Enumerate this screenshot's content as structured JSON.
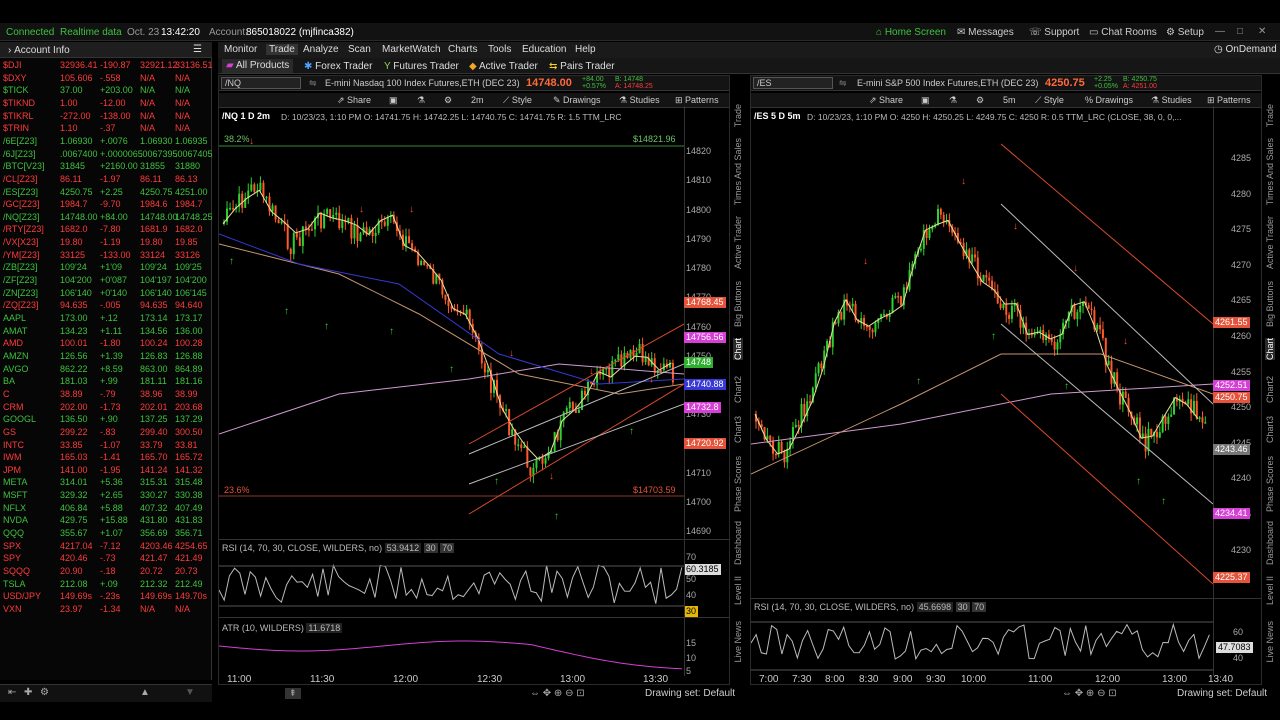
{
  "topbar": {
    "connected": "Connected",
    "realtime": "Realtime data",
    "date": "Oct. 23",
    "time": "13:42:20",
    "account_label": "Account:",
    "account_value": "865018022 (mjfinca382)",
    "home": "Home Screen",
    "messages": "Messages",
    "support": "Support",
    "chatrooms": "Chat Rooms",
    "setup": "Setup",
    "ondemand": "OnDemand"
  },
  "tabs": [
    "Monitor",
    "Trade",
    "Analyze",
    "Scan",
    "MarketWatch",
    "Charts",
    "Tools",
    "Education",
    "Help"
  ],
  "subtabs": [
    "All Products",
    "Forex Trader",
    "Futures Trader",
    "Active Trader",
    "Pairs Trader"
  ],
  "watchlist": {
    "header": "Account Info",
    "rows": [
      {
        "sym": "$DJI",
        "last": "32936.41",
        "chg": "-190.87",
        "bid": "32921.12",
        "ask": "33136.51",
        "up": false
      },
      {
        "sym": "$DXY",
        "last": "105.606",
        "chg": "-.558",
        "bid": "N/A",
        "ask": "N/A",
        "up": false
      },
      {
        "sym": "$TICK",
        "last": "37.00",
        "chg": "+203.00",
        "bid": "N/A",
        "ask": "N/A",
        "up": true
      },
      {
        "sym": "$TIKND",
        "last": "1.00",
        "chg": "-12.00",
        "bid": "N/A",
        "ask": "N/A",
        "up": false
      },
      {
        "sym": "$TIKRL",
        "last": "-272.00",
        "chg": "-138.00",
        "bid": "N/A",
        "ask": "N/A",
        "up": false
      },
      {
        "sym": "$TRIN",
        "last": "1.10",
        "chg": "-.37",
        "bid": "N/A",
        "ask": "N/A",
        "up": false
      },
      {
        "sym": "/6E[Z23]",
        "last": "1.06930",
        "chg": "+.0076",
        "bid": "1.06930",
        "ask": "1.06935",
        "up": true
      },
      {
        "sym": "/6J[Z23]",
        "last": ".0067400",
        "chg": "+.0000065",
        "bid": ".0067395",
        "ask": ".0067405",
        "up": true
      },
      {
        "sym": "/BTC[V23]",
        "last": "31845",
        "chg": "+2160.00",
        "bid": "31855",
        "ask": "31880",
        "up": true
      },
      {
        "sym": "/CL[Z23]",
        "last": "86.11",
        "chg": "-1.97",
        "bid": "86.11",
        "ask": "86.13",
        "up": false
      },
      {
        "sym": "/ES[Z23]",
        "last": "4250.75",
        "chg": "+2.25",
        "bid": "4250.75",
        "ask": "4251.00",
        "up": true
      },
      {
        "sym": "/GC[Z23]",
        "last": "1984.7",
        "chg": "-9.70",
        "bid": "1984.6",
        "ask": "1984.7",
        "up": false
      },
      {
        "sym": "/NQ[Z23]",
        "last": "14748.00",
        "chg": "+84.00",
        "bid": "14748.00",
        "ask": "14748.25",
        "up": true
      },
      {
        "sym": "/RTY[Z23]",
        "last": "1682.0",
        "chg": "-7.80",
        "bid": "1681.9",
        "ask": "1682.0",
        "up": false
      },
      {
        "sym": "/VX[X23]",
        "last": "19.80",
        "chg": "-1.19",
        "bid": "19.80",
        "ask": "19.85",
        "up": false
      },
      {
        "sym": "/YM[Z23]",
        "last": "33125",
        "chg": "-133.00",
        "bid": "33124",
        "ask": "33126",
        "up": false
      },
      {
        "sym": "/ZB[Z23]",
        "last": "109'24",
        "chg": "+1'09",
        "bid": "109'24",
        "ask": "109'25",
        "up": true
      },
      {
        "sym": "/ZF[Z23]",
        "last": "104'200",
        "chg": "+0'087",
        "bid": "104'197",
        "ask": "104'200",
        "up": true
      },
      {
        "sym": "/ZN[Z23]",
        "last": "106'140",
        "chg": "+0'140",
        "bid": "106'140",
        "ask": "106'145",
        "up": true
      },
      {
        "sym": "/ZQ[Z23]",
        "last": "94.635",
        "chg": "-.005",
        "bid": "94.635",
        "ask": "94.640",
        "up": false
      },
      {
        "sym": "AAPL",
        "last": "173.00",
        "chg": "+.12",
        "bid": "173.14",
        "ask": "173.17",
        "up": true
      },
      {
        "sym": "AMAT",
        "last": "134.23",
        "chg": "+1.11",
        "bid": "134.56",
        "ask": "136.00",
        "up": true
      },
      {
        "sym": "AMD",
        "last": "100.01",
        "chg": "-1.80",
        "bid": "100.24",
        "ask": "100.28",
        "up": false
      },
      {
        "sym": "AMZN",
        "last": "126.56",
        "chg": "+1.39",
        "bid": "126.83",
        "ask": "126.88",
        "up": true
      },
      {
        "sym": "AVGO",
        "last": "862.22",
        "chg": "+8.59",
        "bid": "863.00",
        "ask": "864.89",
        "up": true
      },
      {
        "sym": "BA",
        "last": "181.03",
        "chg": "+.99",
        "bid": "181.11",
        "ask": "181.16",
        "up": true
      },
      {
        "sym": "C",
        "last": "38.89",
        "chg": "-.79",
        "bid": "38.96",
        "ask": "38.99",
        "up": false
      },
      {
        "sym": "CRM",
        "last": "202.00",
        "chg": "-1.73",
        "bid": "202.01",
        "ask": "203.68",
        "up": false
      },
      {
        "sym": "GOOGL",
        "last": "136.50",
        "chg": "+.90",
        "bid": "137.25",
        "ask": "137.29",
        "up": true
      },
      {
        "sym": "GS",
        "last": "299.22",
        "chg": "-.83",
        "bid": "299.40",
        "ask": "300.50",
        "up": false
      },
      {
        "sym": "INTC",
        "last": "33.85",
        "chg": "-1.07",
        "bid": "33.79",
        "ask": "33.81",
        "up": false
      },
      {
        "sym": "IWM",
        "last": "165.03",
        "chg": "-1.41",
        "bid": "165.70",
        "ask": "165.72",
        "up": false
      },
      {
        "sym": "JPM",
        "last": "141.00",
        "chg": "-1.95",
        "bid": "141.24",
        "ask": "141.32",
        "up": false
      },
      {
        "sym": "META",
        "last": "314.01",
        "chg": "+5.36",
        "bid": "315.31",
        "ask": "315.48",
        "up": true
      },
      {
        "sym": "MSFT",
        "last": "329.32",
        "chg": "+2.65",
        "bid": "330.27",
        "ask": "330.38",
        "up": true
      },
      {
        "sym": "NFLX",
        "last": "406.84",
        "chg": "+5.88",
        "bid": "407.32",
        "ask": "407.49",
        "up": true
      },
      {
        "sym": "NVDA",
        "last": "429.75",
        "chg": "+15.88",
        "bid": "431.80",
        "ask": "431.83",
        "up": true
      },
      {
        "sym": "QQQ",
        "last": "355.67",
        "chg": "+1.07",
        "bid": "356.69",
        "ask": "356.71",
        "up": true
      },
      {
        "sym": "SPX",
        "last": "4217.04",
        "chg": "-7.12",
        "bid": "4203.46",
        "ask": "4254.65",
        "up": false
      },
      {
        "sym": "SPY",
        "last": "420.46",
        "chg": "-.73",
        "bid": "421.47",
        "ask": "421.49",
        "up": false
      },
      {
        "sym": "SQQQ",
        "last": "20.90",
        "chg": "-.18",
        "bid": "20.72",
        "ask": "20.73",
        "up": false
      },
      {
        "sym": "TSLA",
        "last": "212.08",
        "chg": "+.09",
        "bid": "212.32",
        "ask": "212.49",
        "up": true
      },
      {
        "sym": "USD/JPY",
        "last": "149.69s",
        "chg": "-.23s",
        "bid": "149.69s",
        "ask": "149.70s",
        "up": false
      },
      {
        "sym": "VXN",
        "last": "23.97",
        "chg": "-1.34",
        "bid": "N/A",
        "ask": "N/A",
        "up": false
      }
    ]
  },
  "chart_left": {
    "symbol": "/NQ",
    "desc": "E-mini Nasdaq 100 Index Futures,ETH (DEC 23)",
    "price": "14748.00",
    "bid": "B: 14748",
    "ask": "A: 14748.25",
    "chg": "+84.00",
    "chgpct": "+0.57%",
    "header": "/NQ 1 D 2m",
    "ohlc": "D: 10/23/23, 1:10 PM  O: 14741.75  H: 14742.25  L: 14740.75  C: 14741.75  R: 1.5  TTM_LRC",
    "tf": "2m",
    "fib_top": "38.2%",
    "fib_top_val": "$14821.96",
    "fib_bot": "23.6%",
    "fib_bot_val": "$14703.59",
    "yticks": [
      "14820",
      "14810",
      "14800",
      "14790",
      "14780",
      "14770",
      "14760",
      "14750",
      "14740",
      "14730",
      "14720",
      "14710",
      "14700",
      "14690"
    ],
    "tags": [
      {
        "v": "14768.45",
        "c": "#e5533a"
      },
      {
        "v": "14756.56",
        "c": "#d63fd6"
      },
      {
        "v": "14748",
        "c": "#2fae2f"
      },
      {
        "v": "14740.88",
        "c": "#3838d6"
      },
      {
        "v": "14732.8",
        "c": "#d63fd6"
      },
      {
        "v": "14720.92",
        "c": "#e5533a"
      }
    ],
    "xticks": [
      "11:00",
      "11:30",
      "12:00",
      "12:30",
      "13:00",
      "13:30"
    ],
    "rsi_hdr": "RSI (14, 70, 30, CLOSE, WILDERS, no)",
    "rsi_val": "53.9412",
    "rsi_lvls": [
      "30",
      "70"
    ],
    "rsi_ticks": [
      "70",
      "50",
      "40",
      "30"
    ],
    "rsi_tag": "60.3185",
    "rsi_tag2": "30",
    "atr_hdr": "ATR (10, WILDERS)",
    "atr_val": "11.6718",
    "atr_ticks": [
      "15",
      "10",
      "5"
    ],
    "drawing": "Drawing set: Default"
  },
  "chart_right": {
    "symbol": "/ES",
    "desc": "E-mini S&P 500 Index Futures,ETH (DEC 23)",
    "price": "4250.75",
    "bid": "B: 4250.75",
    "ask": "A: 4251.00",
    "chg": "+2.25",
    "chgpct": "+0.05%",
    "header": "/ES 5 D 5m",
    "ohlc": "D: 10/23/23, 1:10 PM  O: 4250  H: 4250.25  L: 4249.75  C: 4250  R: 0.5  TTM_LRC (CLOSE, 38, 0, 0,...",
    "tf": "5m",
    "yticks": [
      "4285",
      "4280",
      "4275",
      "4270",
      "4265",
      "4260",
      "4255",
      "4250",
      "4245",
      "4240",
      "4235",
      "4230"
    ],
    "tags": [
      {
        "v": "4261.55",
        "c": "#e5533a"
      },
      {
        "v": "4252.51",
        "c": "#d63fd6"
      },
      {
        "v": "4250.75",
        "c": "#e5533a"
      },
      {
        "v": "4243.46",
        "c": "#777"
      },
      {
        "v": "4234.41",
        "c": "#d63fd6"
      },
      {
        "v": "4225.37",
        "c": "#e5533a"
      }
    ],
    "xticks": [
      "7:00",
      "7:30",
      "8:00",
      "8:30",
      "9:00",
      "9:30",
      "10:00",
      "11:00",
      "12:00",
      "13:00",
      "13:40"
    ],
    "rsi_hdr": "RSI (14, 70, 30, CLOSE, WILDERS, no)",
    "rsi_val": "45.6698",
    "rsi_lvls": [
      "30",
      "70"
    ],
    "rsi_ticks": [
      "60",
      "40"
    ],
    "rsi_tag": "47.7083",
    "drawing": "Drawing set: Default"
  },
  "toolbar": {
    "share": "Share",
    "style": "Style",
    "drawings": "Drawings",
    "studies": "Studies",
    "patterns": "Patterns"
  },
  "sidetabs_left": [
    "Trade",
    "Times And Sales",
    "Active Trader",
    "Big Buttons",
    "Chart",
    "Chart2",
    "Chart3",
    "Phase Scores",
    "Dashboard",
    "Level II",
    "Live News"
  ],
  "sidetabs_right": [
    "Trade",
    "Times And Sales",
    "Active Trader",
    "Big Buttons",
    "Chart",
    "Chart2",
    "Chart3",
    "Phase Scores",
    "Dashboard",
    "Level II",
    "Live News"
  ]
}
